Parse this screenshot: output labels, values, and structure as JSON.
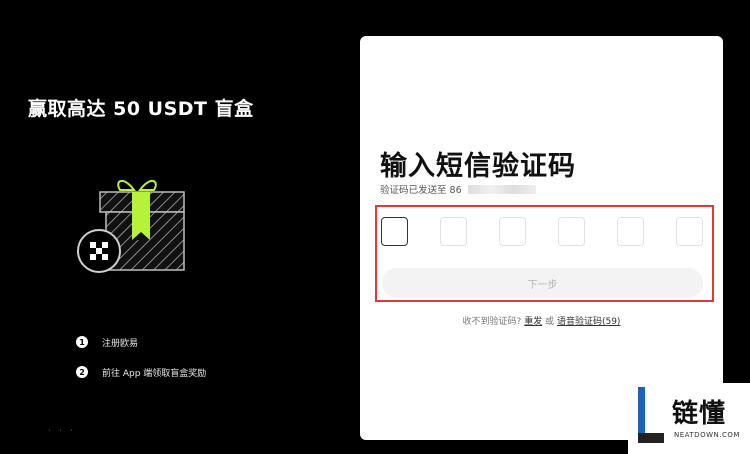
{
  "promo": {
    "title": "赢取高达 50 USDT 盲盒"
  },
  "steps": [
    {
      "num": "1",
      "label": "注册欧易"
    },
    {
      "num": "2",
      "label": "前往 App 端领取盲盒奖励"
    }
  ],
  "footer_dots": "· · ·",
  "card": {
    "title": "输入短信验证码",
    "sent_prefix": "验证码已发送至 86",
    "code_boxes": 6,
    "next_button": "下一步",
    "help": {
      "prefix": "收不到验证码?",
      "resend": "重发",
      "or": "或",
      "voice": "语音验证码(59)"
    }
  },
  "watermark": {
    "brand": "链懂",
    "sub": "NEATDOWN.COM"
  },
  "colors": {
    "background": "#000000",
    "card": "#ffffff",
    "highlight": "#e23838",
    "gift_ribbon": "#b6f23a",
    "watermark_blue": "#1c63b8"
  },
  "icons": [
    "gift-box-icon",
    "okx-logo-icon"
  ]
}
